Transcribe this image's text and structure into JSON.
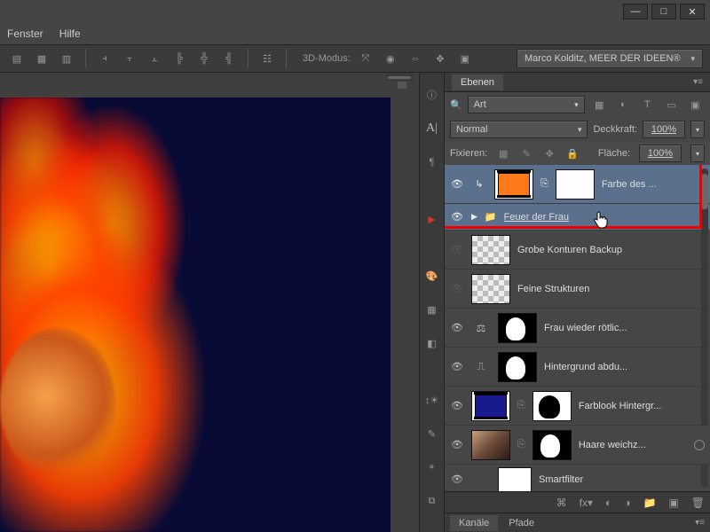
{
  "menu": {
    "fenster": "Fenster",
    "hilfe": "Hilfe"
  },
  "toolbar": {
    "mode3d_label": "3D-Modus:",
    "workspace": "Marco Kolditz, MEER DER IDEEN®"
  },
  "panel": {
    "title": "Ebenen",
    "filter_label": "Art",
    "blend_mode": "Normal",
    "opacity_label": "Deckkraft:",
    "opacity_value": "100%",
    "fill_label": "Fläche:",
    "fill_value": "100%",
    "lock_label": "Fixieren:"
  },
  "layers": [
    {
      "name": "Farbe des ..."
    },
    {
      "name": "Feuer der Frau"
    },
    {
      "name": "Grobe Konturen Backup"
    },
    {
      "name": "Feine Strukturen"
    },
    {
      "name": "Frau wieder rötlic..."
    },
    {
      "name": "Hintergrund abdu..."
    },
    {
      "name": "Farblook Hintergr..."
    },
    {
      "name": "Haare weichz..."
    },
    {
      "name": "Smartfilter"
    }
  ],
  "tabs": {
    "kanale": "Kanäle",
    "pfade": "Pfade"
  }
}
